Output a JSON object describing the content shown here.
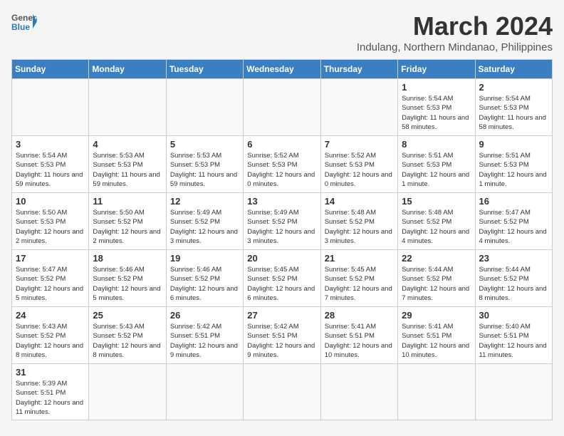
{
  "header": {
    "logo_general": "General",
    "logo_blue": "Blue",
    "month_title": "March 2024",
    "location": "Indulang, Northern Mindanao, Philippines"
  },
  "weekdays": [
    "Sunday",
    "Monday",
    "Tuesday",
    "Wednesday",
    "Thursday",
    "Friday",
    "Saturday"
  ],
  "days": [
    {
      "date": "",
      "info": ""
    },
    {
      "date": "",
      "info": ""
    },
    {
      "date": "",
      "info": ""
    },
    {
      "date": "",
      "info": ""
    },
    {
      "date": "",
      "info": ""
    },
    {
      "date": "1",
      "info": "Sunrise: 5:54 AM\nSunset: 5:53 PM\nDaylight: 11 hours\nand 58 minutes."
    },
    {
      "date": "2",
      "info": "Sunrise: 5:54 AM\nSunset: 5:53 PM\nDaylight: 11 hours\nand 58 minutes."
    },
    {
      "date": "3",
      "info": "Sunrise: 5:54 AM\nSunset: 5:53 PM\nDaylight: 11 hours\nand 59 minutes."
    },
    {
      "date": "4",
      "info": "Sunrise: 5:53 AM\nSunset: 5:53 PM\nDaylight: 11 hours\nand 59 minutes."
    },
    {
      "date": "5",
      "info": "Sunrise: 5:53 AM\nSunset: 5:53 PM\nDaylight: 11 hours\nand 59 minutes."
    },
    {
      "date": "6",
      "info": "Sunrise: 5:52 AM\nSunset: 5:53 PM\nDaylight: 12 hours\nand 0 minutes."
    },
    {
      "date": "7",
      "info": "Sunrise: 5:52 AM\nSunset: 5:53 PM\nDaylight: 12 hours\nand 0 minutes."
    },
    {
      "date": "8",
      "info": "Sunrise: 5:51 AM\nSunset: 5:53 PM\nDaylight: 12 hours\nand 1 minute."
    },
    {
      "date": "9",
      "info": "Sunrise: 5:51 AM\nSunset: 5:53 PM\nDaylight: 12 hours\nand 1 minute."
    },
    {
      "date": "10",
      "info": "Sunrise: 5:50 AM\nSunset: 5:53 PM\nDaylight: 12 hours\nand 2 minutes."
    },
    {
      "date": "11",
      "info": "Sunrise: 5:50 AM\nSunset: 5:52 PM\nDaylight: 12 hours\nand 2 minutes."
    },
    {
      "date": "12",
      "info": "Sunrise: 5:49 AM\nSunset: 5:52 PM\nDaylight: 12 hours\nand 3 minutes."
    },
    {
      "date": "13",
      "info": "Sunrise: 5:49 AM\nSunset: 5:52 PM\nDaylight: 12 hours\nand 3 minutes."
    },
    {
      "date": "14",
      "info": "Sunrise: 5:48 AM\nSunset: 5:52 PM\nDaylight: 12 hours\nand 3 minutes."
    },
    {
      "date": "15",
      "info": "Sunrise: 5:48 AM\nSunset: 5:52 PM\nDaylight: 12 hours\nand 4 minutes."
    },
    {
      "date": "16",
      "info": "Sunrise: 5:47 AM\nSunset: 5:52 PM\nDaylight: 12 hours\nand 4 minutes."
    },
    {
      "date": "17",
      "info": "Sunrise: 5:47 AM\nSunset: 5:52 PM\nDaylight: 12 hours\nand 5 minutes."
    },
    {
      "date": "18",
      "info": "Sunrise: 5:46 AM\nSunset: 5:52 PM\nDaylight: 12 hours\nand 5 minutes."
    },
    {
      "date": "19",
      "info": "Sunrise: 5:46 AM\nSunset: 5:52 PM\nDaylight: 12 hours\nand 6 minutes."
    },
    {
      "date": "20",
      "info": "Sunrise: 5:45 AM\nSunset: 5:52 PM\nDaylight: 12 hours\nand 6 minutes."
    },
    {
      "date": "21",
      "info": "Sunrise: 5:45 AM\nSunset: 5:52 PM\nDaylight: 12 hours\nand 7 minutes."
    },
    {
      "date": "22",
      "info": "Sunrise: 5:44 AM\nSunset: 5:52 PM\nDaylight: 12 hours\nand 7 minutes."
    },
    {
      "date": "23",
      "info": "Sunrise: 5:44 AM\nSunset: 5:52 PM\nDaylight: 12 hours\nand 8 minutes."
    },
    {
      "date": "24",
      "info": "Sunrise: 5:43 AM\nSunset: 5:52 PM\nDaylight: 12 hours\nand 8 minutes."
    },
    {
      "date": "25",
      "info": "Sunrise: 5:43 AM\nSunset: 5:52 PM\nDaylight: 12 hours\nand 8 minutes."
    },
    {
      "date": "26",
      "info": "Sunrise: 5:42 AM\nSunset: 5:51 PM\nDaylight: 12 hours\nand 9 minutes."
    },
    {
      "date": "27",
      "info": "Sunrise: 5:42 AM\nSunset: 5:51 PM\nDaylight: 12 hours\nand 9 minutes."
    },
    {
      "date": "28",
      "info": "Sunrise: 5:41 AM\nSunset: 5:51 PM\nDaylight: 12 hours\nand 10 minutes."
    },
    {
      "date": "29",
      "info": "Sunrise: 5:41 AM\nSunset: 5:51 PM\nDaylight: 12 hours\nand 10 minutes."
    },
    {
      "date": "30",
      "info": "Sunrise: 5:40 AM\nSunset: 5:51 PM\nDaylight: 12 hours\nand 11 minutes."
    },
    {
      "date": "31",
      "info": "Sunrise: 5:39 AM\nSunset: 5:51 PM\nDaylight: 12 hours\nand 11 minutes."
    },
    {
      "date": "",
      "info": ""
    },
    {
      "date": "",
      "info": ""
    },
    {
      "date": "",
      "info": ""
    },
    {
      "date": "",
      "info": ""
    },
    {
      "date": "",
      "info": ""
    },
    {
      "date": "",
      "info": ""
    }
  ]
}
